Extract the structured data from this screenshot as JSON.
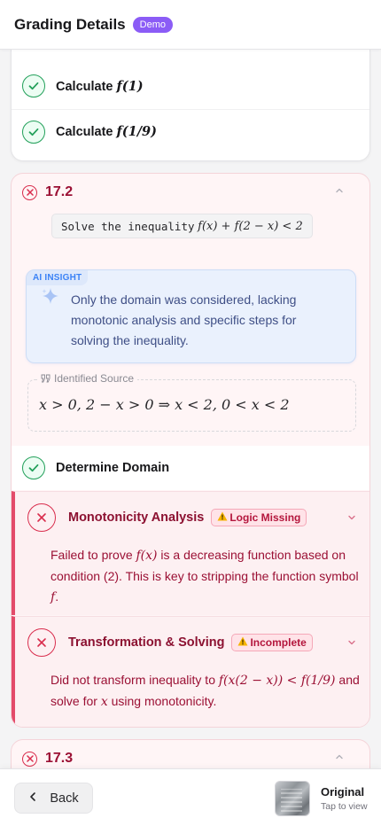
{
  "header": {
    "title": "Grading Details",
    "badge": "Demo"
  },
  "steps_top": [
    {
      "label": "Calculate",
      "math": "f(1)"
    },
    {
      "label": "Calculate",
      "math": "f(1/9)"
    }
  ],
  "question": {
    "number": "17.2",
    "prompt_text": "Solve the inequality",
    "prompt_math": "f(x) + f(2 − x) < 2",
    "insight": {
      "tag": "AI INSIGHT",
      "text": "Only the domain was considered, lacking monotonic analysis and specific steps for solving the inequality."
    },
    "source": {
      "label": "Identified Source",
      "formula": "x > 0, 2 − x > 0 ⇒ x < 2, 0 < x < 2"
    },
    "steps": [
      {
        "label": "Determine Domain",
        "status": "ok"
      },
      {
        "title": "Monotonicity Analysis",
        "badge": "Logic Missing",
        "status": "error",
        "text": [
          "Failed to prove ",
          "f(x)",
          " is a decreasing function based on condition (2). This is key to stripping the function symbol ",
          "f",
          "."
        ]
      },
      {
        "title": "Transformation & Solving",
        "badge": "Incomplete",
        "status": "error",
        "text": [
          "Did not transform inequality to ",
          "f(x(2 − x)) < f(1/9)",
          " and solve for ",
          "x",
          " using monotonicity."
        ]
      }
    ]
  },
  "next_question": {
    "number": "17.3"
  },
  "footer": {
    "back_label": "Back",
    "original_title": "Original",
    "original_sub": "Tap to view"
  },
  "colors": {
    "accent_purple": "#8b5cf6",
    "success": "#22a05a",
    "error": "#d92d4d",
    "insight_blue": "#3b82f6"
  }
}
